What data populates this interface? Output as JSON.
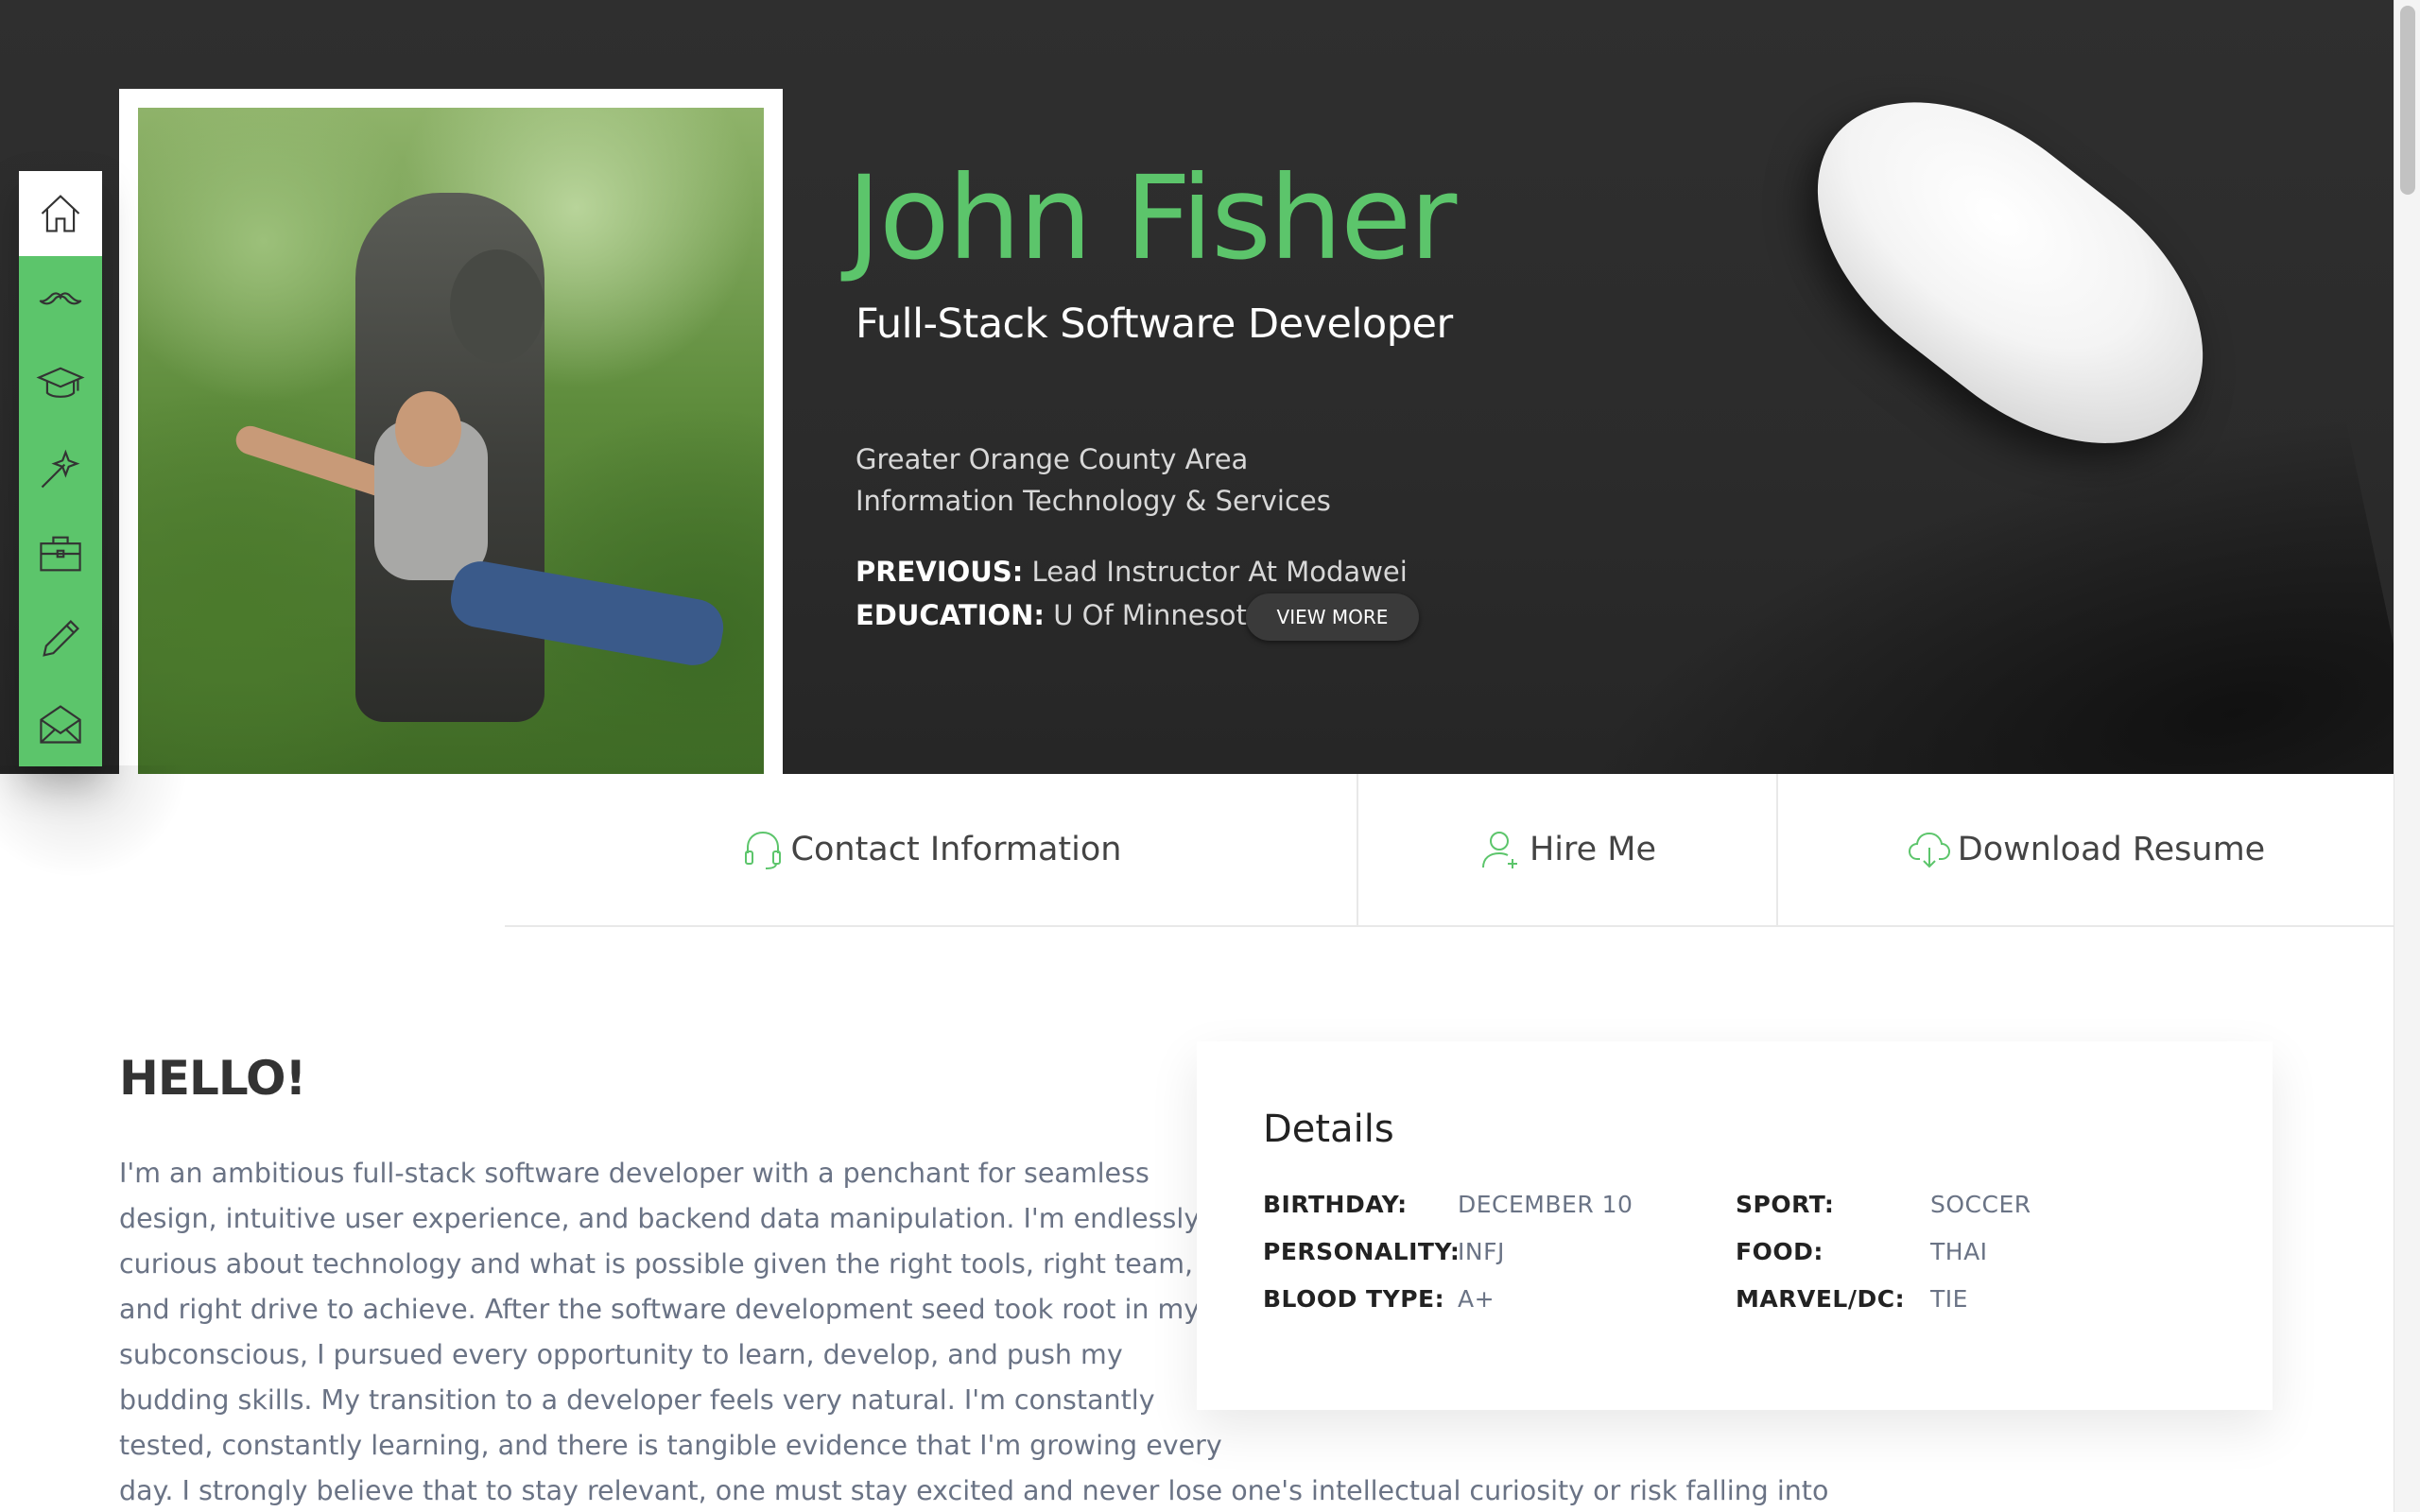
{
  "nav": {
    "items": [
      {
        "icon": "home-icon",
        "active": true
      },
      {
        "icon": "mustache-icon",
        "active": false
      },
      {
        "icon": "graduation-cap-icon",
        "active": false
      },
      {
        "icon": "magic-wand-icon",
        "active": false
      },
      {
        "icon": "briefcase-icon",
        "active": false
      },
      {
        "icon": "pencil-icon",
        "active": false
      },
      {
        "icon": "envelope-icon",
        "active": false
      }
    ]
  },
  "hero": {
    "name": "John Fisher",
    "role": "Full-Stack Software Developer",
    "location": "Greater Orange County Area",
    "industry": "Information Technology & Services",
    "previous_label": "PREVIOUS:",
    "previous_value": "Lead Instructor At Modawei",
    "education_label": "EDUCATION:",
    "education_value": "U Of Minnesota",
    "view_more": "VIEW MORE"
  },
  "actions": {
    "contact": "Contact Information",
    "hire": "Hire Me",
    "resume": "Download Resume"
  },
  "about": {
    "heading": "HELLO!",
    "lines": [
      "I'm an ambitious full-stack software developer with a penchant for seamless",
      "design, intuitive user experience, and backend data manipulation. I'm endlessly",
      "curious about technology and what is possible given the right tools, right team,",
      "and right drive to achieve. After the software development seed took root in my",
      "subconscious, I pursued every opportunity to learn, develop, and push my",
      "budding skills. My transition to a developer feels very natural. I'm constantly",
      "tested, constantly learning, and there is tangible evidence that I'm growing every",
      "day. I strongly believe that to stay relevant, one must stay excited and never lose one's intellectual curiosity or risk falling into obscurity."
    ]
  },
  "details": {
    "title": "Details",
    "rows": [
      {
        "label": "BIRTHDAY:",
        "value": "DECEMBER 10"
      },
      {
        "label": "PERSONALITY:",
        "value": "INFJ"
      },
      {
        "label": "BLOOD TYPE:",
        "value": "A+"
      },
      {
        "label": "SPORT:",
        "value": "SOCCER"
      },
      {
        "label": "FOOD:",
        "value": "THAI"
      },
      {
        "label": "MARVEL/DC:",
        "value": "TIE"
      }
    ]
  },
  "colors": {
    "accent": "#5cc56b",
    "hero_bg": "#2d2d2d",
    "body_text": "#6a7385"
  }
}
